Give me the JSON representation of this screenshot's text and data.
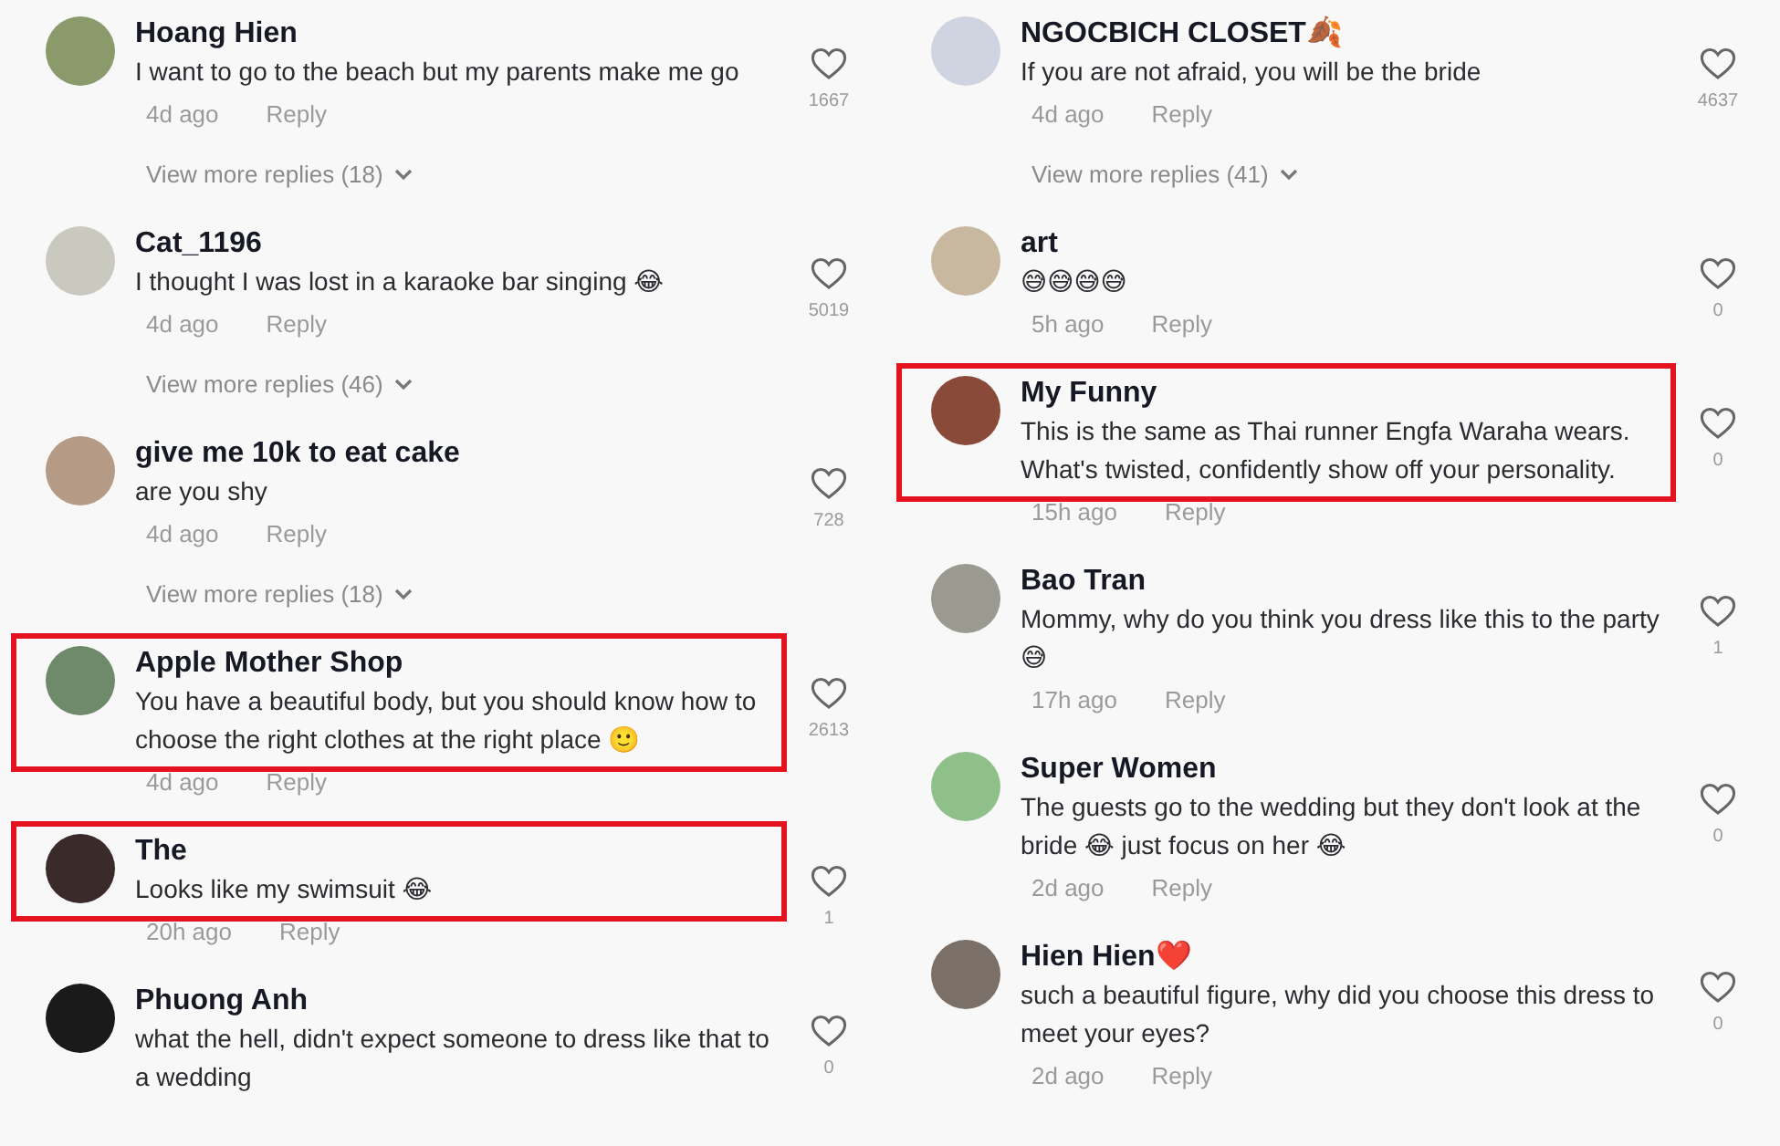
{
  "columns": [
    {
      "comments": [
        {
          "name": "Hoang Hien",
          "text": "I want to go to the beach but my parents make me go",
          "time": "4d ago",
          "reply": "Reply",
          "likes": "1667",
          "highlighted": false,
          "more_replies": "View more replies (18)"
        },
        {
          "name": "Cat_1196",
          "text": "I thought I was lost in a karaoke bar singing 😂",
          "time": "4d ago",
          "reply": "Reply",
          "likes": "5019",
          "highlighted": false,
          "more_replies": "View more replies (46)"
        },
        {
          "name": "give me 10k to eat cake",
          "text": "are you shy",
          "time": "4d ago",
          "reply": "Reply",
          "likes": "728",
          "highlighted": false,
          "more_replies": "View more replies (18)"
        },
        {
          "name": "Apple Mother Shop",
          "text": "You have a beautiful body, but you should know how to choose the right clothes at the right place 🙂",
          "time": "4d ago",
          "reply": "Reply",
          "likes": "2613",
          "highlighted": true
        },
        {
          "name": "The",
          "text": "Looks like my swimsuit 😂",
          "time": "20h ago",
          "reply": "Reply",
          "likes": "1",
          "highlighted": true
        },
        {
          "name": "Phuong Anh",
          "text": "what the hell, didn't expect someone to dress like that to a wedding",
          "likes": "0",
          "highlighted": false
        }
      ]
    },
    {
      "comments": [
        {
          "name": "NGOCBICH CLOSET🍂",
          "text": "If you are not afraid, you will be the bride",
          "time": "4d ago",
          "reply": "Reply",
          "likes": "4637",
          "highlighted": false,
          "more_replies": "View more replies (41)"
        },
        {
          "name": "art",
          "text": "😅😅😅😅",
          "time": "5h ago",
          "reply": "Reply",
          "likes": "0",
          "highlighted": false
        },
        {
          "name": "My Funny",
          "text": "This is the same as Thai runner Engfa Waraha wears. What's twisted, confidently show off your personality.",
          "time": "15h ago",
          "reply": "Reply",
          "likes": "0",
          "highlighted": true
        },
        {
          "name": "Bao Tran",
          "text": "Mommy, why do you think you dress like this to the party 😅",
          "time": "17h ago",
          "reply": "Reply",
          "likes": "1",
          "highlighted": false
        },
        {
          "name": "Super Women",
          "text": "The guests go to the wedding but they don't look at the bride 😂 just focus on her 😂",
          "time": "2d ago",
          "reply": "Reply",
          "likes": "0",
          "highlighted": false
        },
        {
          "name": "Hien Hien❤️",
          "text": "such a beautiful figure, why did you choose this dress to meet your eyes?",
          "time": "2d ago",
          "reply": "Reply",
          "likes": "0",
          "highlighted": false
        }
      ]
    }
  ]
}
